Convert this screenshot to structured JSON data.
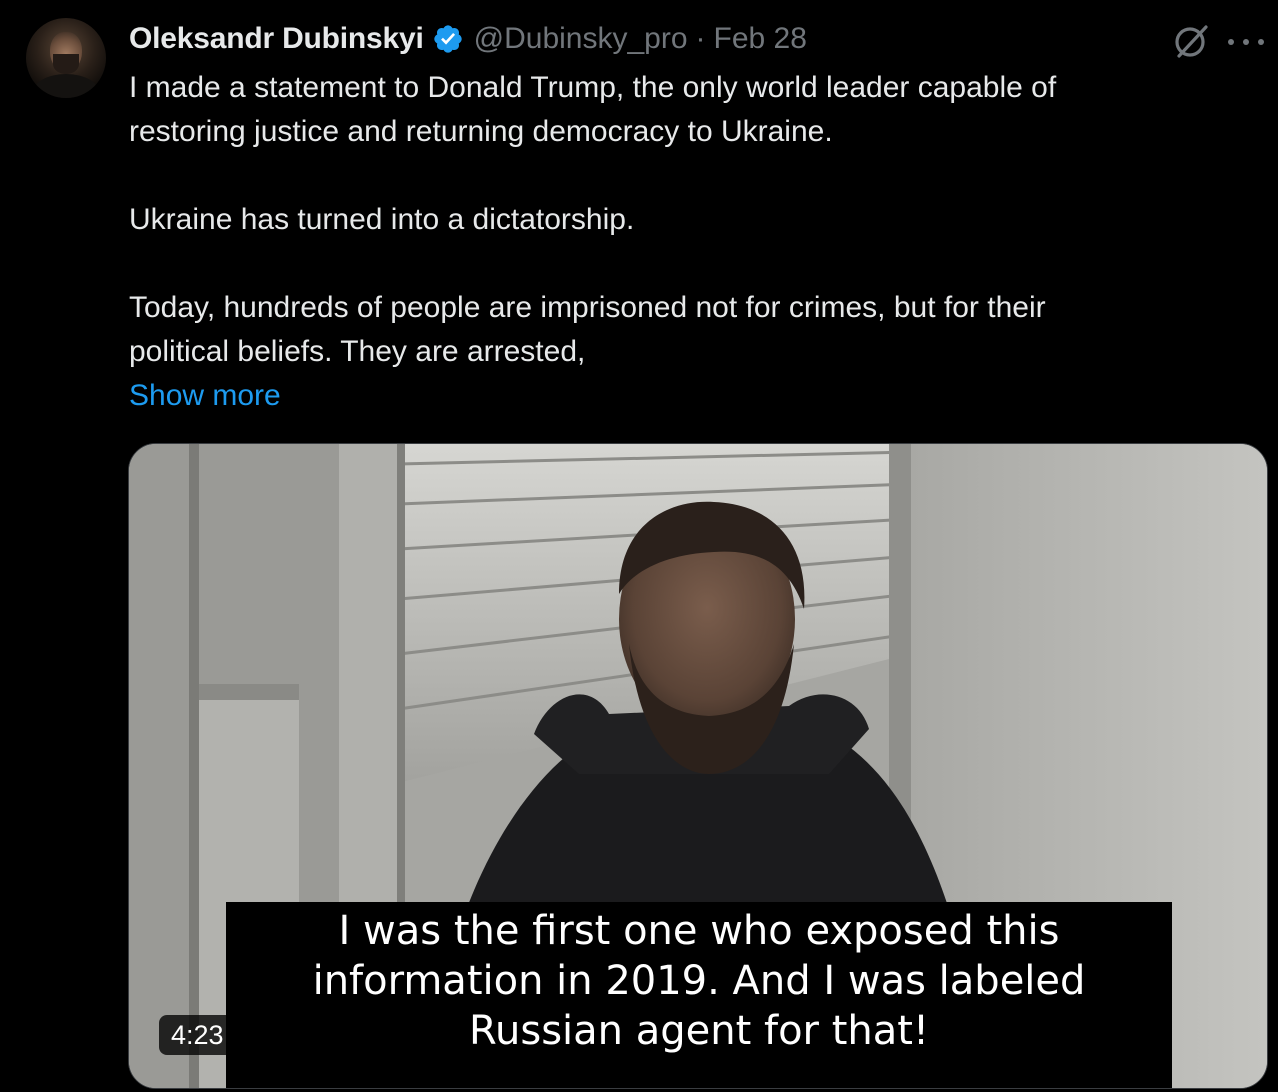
{
  "author": {
    "name": "Oleksandr Dubinskyi",
    "handle": "@Dubinsky_pro",
    "separator": "·",
    "date": "Feb 28"
  },
  "icons": {
    "verified": "verified-badge-icon",
    "grok": "grok-icon",
    "more": "more-icon"
  },
  "colors": {
    "background": "#000000",
    "text": "#e7e9ea",
    "secondary": "#71767b",
    "accent": "#1d9bf0"
  },
  "tweet": {
    "line1": "I made a statement to Donald Trump, the only world leader capable of",
    "line2": "restoring justice and returning democracy to Ukraine.",
    "line3": "Ukraine has turned into a dictatorship.",
    "line4": "Today, hundreds of people are imprisoned not for crimes, but for their",
    "line5": "political beliefs. They are arrested,",
    "show_more": "Show more"
  },
  "video": {
    "caption": [
      "I was the first one who exposed this",
      "information in 2019. And I was labeled",
      "Russian agent for that!"
    ],
    "duration": "4:23"
  }
}
